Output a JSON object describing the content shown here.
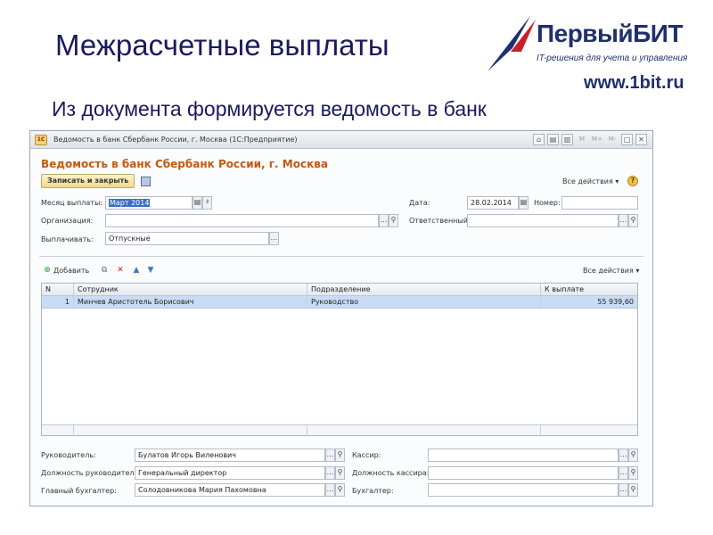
{
  "slide": {
    "title": "Межрасчетные выплаты",
    "subtitle": "Из документа формируется ведомость в банк",
    "logo_name": "ПервыйБИТ",
    "logo_tagline": "IT-решения для учета и управления",
    "logo_www": "www.1bit.ru"
  },
  "window": {
    "app_icon": "1С",
    "title": "Ведомость в банк Сбербанк России, г. Москва (1С:Предприятие)",
    "heading": "Ведомость в банк Сбербанк России, г. Москва",
    "titlebar_buttons": [
      "⌂",
      "▤",
      "▥",
      "M",
      "M+",
      "M-",
      "□",
      "✕"
    ]
  },
  "toolbar": {
    "save_close_label": "Записать и закрыть",
    "all_actions_label": "Все действия ▾",
    "help_label": "?"
  },
  "form": {
    "month_label": "Месяц выплаты:",
    "month_value": "Март 2014",
    "date_label": "Дата:",
    "date_value": "28.02.2014",
    "number_label": "Номер:",
    "number_value": "",
    "org_label": "Организация:",
    "org_value": "",
    "responsible_label": "Ответственный:",
    "responsible_value": "",
    "pay_label": "Выплачивать:",
    "pay_value": "Отпускные"
  },
  "table_toolbar": {
    "add_label": "Добавить",
    "all_actions_label": "Все действия ▾"
  },
  "table": {
    "columns": [
      "N",
      "Сотрудник",
      "Подразделение",
      "К выплате"
    ],
    "rows": [
      [
        "1",
        "Минчев Аристотель Борисович",
        "Руководство",
        "55 939,60"
      ]
    ]
  },
  "signatures": {
    "head_label": "Руководитель:",
    "head_value": "Булатов Игорь Виленович",
    "head_pos_label": "Должность руководителя:",
    "head_pos_value": "Генеральный директор",
    "chief_acc_label": "Главный бухгалтер:",
    "chief_acc_value": "Солодовникова Мария Пахомовна",
    "cashier_label": "Кассир:",
    "cashier_value": "",
    "cashier_pos_label": "Должность кассира:",
    "cashier_pos_value": "",
    "accountant_label": "Бухгалтер:",
    "accountant_value": ""
  },
  "colors": {
    "heading": "#c25a12",
    "selection": "#c8dcf6",
    "title_text": "#1a1a5e"
  }
}
